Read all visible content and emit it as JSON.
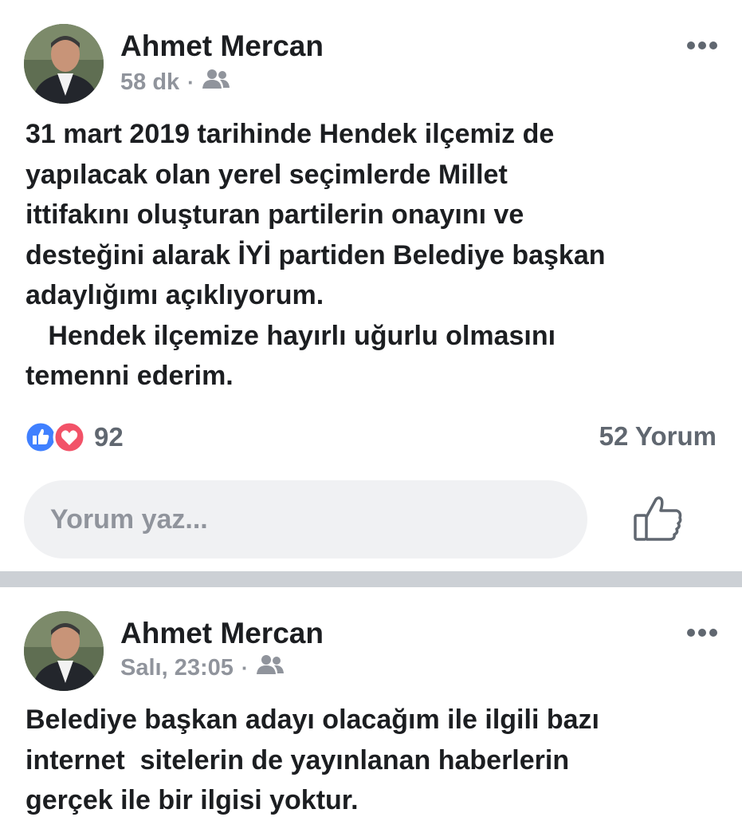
{
  "posts": [
    {
      "author": "Ahmet Mercan",
      "time": "58 dk",
      "separator": "·",
      "audience_icon": "friends-icon",
      "text": "31 mart 2019 tarihinde Hendek ilçemiz de\nyapılacak olan yerel seçimlerde Millet\nittifakını oluşturan partilerin onayını ve\ndesteğini alarak İYİ partiden Belediye başkan\nadaylığımı açıklıyorum.\n   Hendek ilçemize hayırlı uğurlu olmasını\ntemenni ederim.",
      "reactions": {
        "icons": [
          "like-icon",
          "love-icon"
        ],
        "count": "92"
      },
      "comments": "52 Yorum",
      "comment_placeholder": "Yorum yaz..."
    },
    {
      "author": "Ahmet Mercan",
      "time": "Salı, 23:05",
      "separator": "·",
      "audience_icon": "friends-icon",
      "text": "Belediye başkan adayı olacağım ile ilgili bazı\ninternet  sitelerin de yayınlanan haberlerin\ngerçek ile bir ilgisi yoktur."
    }
  ],
  "colors": {
    "like_blue": "#4080ff",
    "love_red": "#f25268",
    "secondary_text": "#90949c",
    "divider": "#ccd0d5"
  }
}
